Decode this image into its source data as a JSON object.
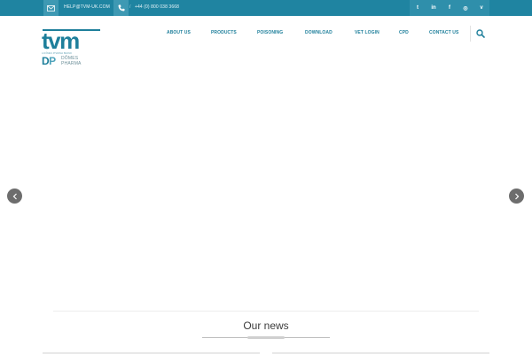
{
  "topbar": {
    "email": "HELP@TVM-UK.COM",
    "phone": "+44 (0) 800 038 3668",
    "social": [
      {
        "name": "twitter",
        "glyph": "t"
      },
      {
        "name": "linkedin",
        "glyph": "in"
      },
      {
        "name": "facebook",
        "glyph": "f"
      },
      {
        "name": "instagram",
        "glyph": "◎"
      },
      {
        "name": "vimeo",
        "glyph": "v"
      }
    ]
  },
  "logo": {
    "main": "tvm",
    "tagline": "A DÔMES PHARMA BRAND",
    "dp": "D",
    "dp_p": "P",
    "dp_line1": "DÔMES",
    "dp_line2": "PHARMA"
  },
  "nav": {
    "items": [
      "ABOUT US",
      "PRODUCTS",
      "POISONING",
      "DOWNLOAD",
      "VET LOGIN",
      "CPD",
      "CONTACT US"
    ]
  },
  "news": {
    "title": "Our news"
  },
  "colors": {
    "brand": "#1e7f9b",
    "topbar": "#1f84a1"
  }
}
